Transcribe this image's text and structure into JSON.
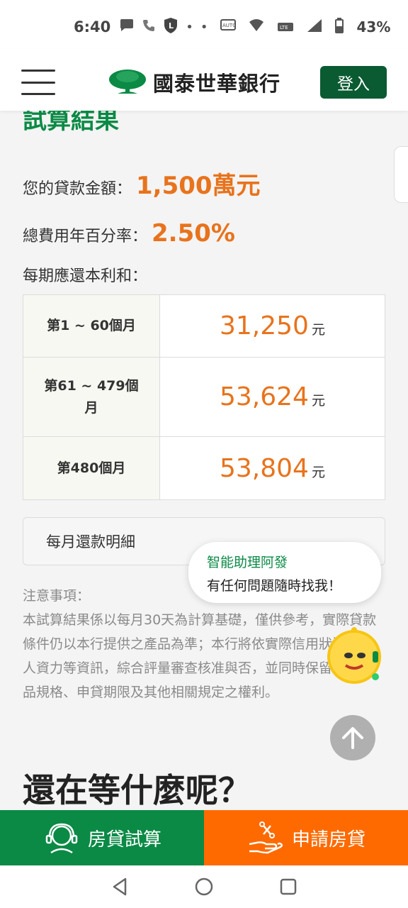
{
  "status_bar": {
    "time": "6:40",
    "battery": "43%"
  },
  "header": {
    "brand_name": "國泰世華銀行",
    "login_label": "登入"
  },
  "result": {
    "title": "試算結果",
    "loan_amount_label": "您的貸款金額：",
    "loan_amount_value": "1,500萬元",
    "apr_label": "總費用年百分率：",
    "apr_value": "2.50%",
    "period_label": "每期應還本利和："
  },
  "payment_table": {
    "rows": [
      {
        "period": "第1 ~ 60個月",
        "amount": "31,250",
        "unit": "元"
      },
      {
        "period": "第61 ~ 479個月",
        "amount": "53,624",
        "unit": "元"
      },
      {
        "period": "第480個月",
        "amount": "53,804",
        "unit": "元"
      }
    ]
  },
  "detail": {
    "label": "每月還款明細"
  },
  "notes": {
    "title": "注意事項：",
    "body": "本試算結果係以每月30天為計算基礎，僅供參考，實際貸款條件仍以本行提供之產品為準；本行將依實際信用狀況及個人資力等資訊，綜合評量審查核准與否，並同時保留調整產品規格、申貸期限及其他相關規定之權利。"
  },
  "cta": {
    "heading": "還在等什麼呢？"
  },
  "assistant": {
    "name": "智能助理阿發",
    "message": "有任何問題隨時找我！"
  },
  "action_bar": {
    "calc_label": "房貸試算",
    "apply_label": "申請房貸"
  },
  "colors": {
    "brand_green": "#0a8a45",
    "dark_green": "#0a5a32",
    "accent_orange": "#e8731c",
    "apply_orange": "#ff6a00"
  }
}
